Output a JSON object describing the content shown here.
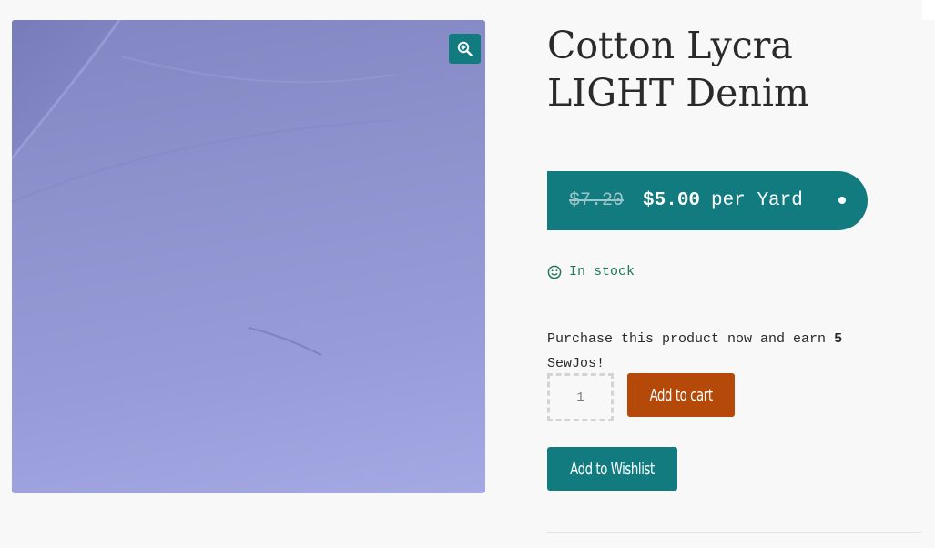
{
  "product": {
    "title": "Cotton Lycra LIGHT Denim",
    "image_alt": "Light denim blue cotton lycra fabric",
    "image_color": "#8d92cd",
    "zoom_icon": "zoom-in-icon"
  },
  "price": {
    "old": "$7.20",
    "new": "$5.00",
    "unit": "per Yard",
    "color": "#127b7f"
  },
  "stock": {
    "icon": "smile-icon",
    "label": "In stock",
    "color": "#22775f"
  },
  "points": {
    "prefix": "Purchase this product now and earn",
    "amount": "5",
    "suffix": "SewJos!"
  },
  "cart": {
    "quantity": "1",
    "add_to_cart_label": "Add to cart",
    "add_to_cart_color": "#b5490a",
    "wishlist_label": "Add to Wishlist",
    "wishlist_color": "#127b7f"
  }
}
